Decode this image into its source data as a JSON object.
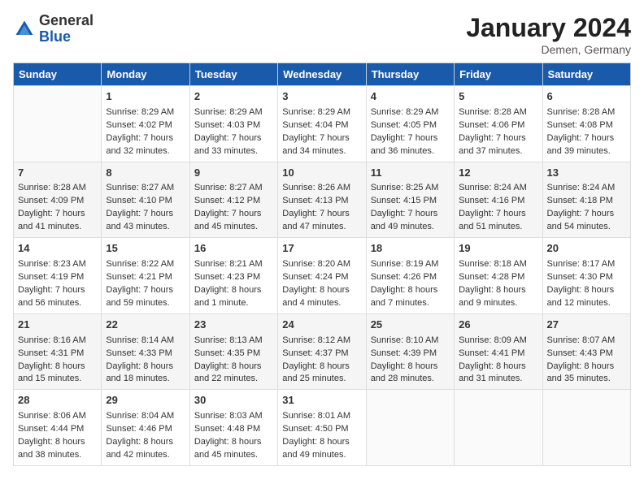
{
  "header": {
    "logo_general": "General",
    "logo_blue": "Blue",
    "month_title": "January 2024",
    "location": "Demen, Germany"
  },
  "days_of_week": [
    "Sunday",
    "Monday",
    "Tuesday",
    "Wednesday",
    "Thursday",
    "Friday",
    "Saturday"
  ],
  "weeks": [
    [
      {
        "day": "",
        "empty": true
      },
      {
        "day": "1",
        "sunrise": "Sunrise: 8:29 AM",
        "sunset": "Sunset: 4:02 PM",
        "daylight": "Daylight: 7 hours and 32 minutes."
      },
      {
        "day": "2",
        "sunrise": "Sunrise: 8:29 AM",
        "sunset": "Sunset: 4:03 PM",
        "daylight": "Daylight: 7 hours and 33 minutes."
      },
      {
        "day": "3",
        "sunrise": "Sunrise: 8:29 AM",
        "sunset": "Sunset: 4:04 PM",
        "daylight": "Daylight: 7 hours and 34 minutes."
      },
      {
        "day": "4",
        "sunrise": "Sunrise: 8:29 AM",
        "sunset": "Sunset: 4:05 PM",
        "daylight": "Daylight: 7 hours and 36 minutes."
      },
      {
        "day": "5",
        "sunrise": "Sunrise: 8:28 AM",
        "sunset": "Sunset: 4:06 PM",
        "daylight": "Daylight: 7 hours and 37 minutes."
      },
      {
        "day": "6",
        "sunrise": "Sunrise: 8:28 AM",
        "sunset": "Sunset: 4:08 PM",
        "daylight": "Daylight: 7 hours and 39 minutes."
      }
    ],
    [
      {
        "day": "7",
        "sunrise": "Sunrise: 8:28 AM",
        "sunset": "Sunset: 4:09 PM",
        "daylight": "Daylight: 7 hours and 41 minutes."
      },
      {
        "day": "8",
        "sunrise": "Sunrise: 8:27 AM",
        "sunset": "Sunset: 4:10 PM",
        "daylight": "Daylight: 7 hours and 43 minutes."
      },
      {
        "day": "9",
        "sunrise": "Sunrise: 8:27 AM",
        "sunset": "Sunset: 4:12 PM",
        "daylight": "Daylight: 7 hours and 45 minutes."
      },
      {
        "day": "10",
        "sunrise": "Sunrise: 8:26 AM",
        "sunset": "Sunset: 4:13 PM",
        "daylight": "Daylight: 7 hours and 47 minutes."
      },
      {
        "day": "11",
        "sunrise": "Sunrise: 8:25 AM",
        "sunset": "Sunset: 4:15 PM",
        "daylight": "Daylight: 7 hours and 49 minutes."
      },
      {
        "day": "12",
        "sunrise": "Sunrise: 8:24 AM",
        "sunset": "Sunset: 4:16 PM",
        "daylight": "Daylight: 7 hours and 51 minutes."
      },
      {
        "day": "13",
        "sunrise": "Sunrise: 8:24 AM",
        "sunset": "Sunset: 4:18 PM",
        "daylight": "Daylight: 7 hours and 54 minutes."
      }
    ],
    [
      {
        "day": "14",
        "sunrise": "Sunrise: 8:23 AM",
        "sunset": "Sunset: 4:19 PM",
        "daylight": "Daylight: 7 hours and 56 minutes."
      },
      {
        "day": "15",
        "sunrise": "Sunrise: 8:22 AM",
        "sunset": "Sunset: 4:21 PM",
        "daylight": "Daylight: 7 hours and 59 minutes."
      },
      {
        "day": "16",
        "sunrise": "Sunrise: 8:21 AM",
        "sunset": "Sunset: 4:23 PM",
        "daylight": "Daylight: 8 hours and 1 minute."
      },
      {
        "day": "17",
        "sunrise": "Sunrise: 8:20 AM",
        "sunset": "Sunset: 4:24 PM",
        "daylight": "Daylight: 8 hours and 4 minutes."
      },
      {
        "day": "18",
        "sunrise": "Sunrise: 8:19 AM",
        "sunset": "Sunset: 4:26 PM",
        "daylight": "Daylight: 8 hours and 7 minutes."
      },
      {
        "day": "19",
        "sunrise": "Sunrise: 8:18 AM",
        "sunset": "Sunset: 4:28 PM",
        "daylight": "Daylight: 8 hours and 9 minutes."
      },
      {
        "day": "20",
        "sunrise": "Sunrise: 8:17 AM",
        "sunset": "Sunset: 4:30 PM",
        "daylight": "Daylight: 8 hours and 12 minutes."
      }
    ],
    [
      {
        "day": "21",
        "sunrise": "Sunrise: 8:16 AM",
        "sunset": "Sunset: 4:31 PM",
        "daylight": "Daylight: 8 hours and 15 minutes."
      },
      {
        "day": "22",
        "sunrise": "Sunrise: 8:14 AM",
        "sunset": "Sunset: 4:33 PM",
        "daylight": "Daylight: 8 hours and 18 minutes."
      },
      {
        "day": "23",
        "sunrise": "Sunrise: 8:13 AM",
        "sunset": "Sunset: 4:35 PM",
        "daylight": "Daylight: 8 hours and 22 minutes."
      },
      {
        "day": "24",
        "sunrise": "Sunrise: 8:12 AM",
        "sunset": "Sunset: 4:37 PM",
        "daylight": "Daylight: 8 hours and 25 minutes."
      },
      {
        "day": "25",
        "sunrise": "Sunrise: 8:10 AM",
        "sunset": "Sunset: 4:39 PM",
        "daylight": "Daylight: 8 hours and 28 minutes."
      },
      {
        "day": "26",
        "sunrise": "Sunrise: 8:09 AM",
        "sunset": "Sunset: 4:41 PM",
        "daylight": "Daylight: 8 hours and 31 minutes."
      },
      {
        "day": "27",
        "sunrise": "Sunrise: 8:07 AM",
        "sunset": "Sunset: 4:43 PM",
        "daylight": "Daylight: 8 hours and 35 minutes."
      }
    ],
    [
      {
        "day": "28",
        "sunrise": "Sunrise: 8:06 AM",
        "sunset": "Sunset: 4:44 PM",
        "daylight": "Daylight: 8 hours and 38 minutes."
      },
      {
        "day": "29",
        "sunrise": "Sunrise: 8:04 AM",
        "sunset": "Sunset: 4:46 PM",
        "daylight": "Daylight: 8 hours and 42 minutes."
      },
      {
        "day": "30",
        "sunrise": "Sunrise: 8:03 AM",
        "sunset": "Sunset: 4:48 PM",
        "daylight": "Daylight: 8 hours and 45 minutes."
      },
      {
        "day": "31",
        "sunrise": "Sunrise: 8:01 AM",
        "sunset": "Sunset: 4:50 PM",
        "daylight": "Daylight: 8 hours and 49 minutes."
      },
      {
        "day": "",
        "empty": true
      },
      {
        "day": "",
        "empty": true
      },
      {
        "day": "",
        "empty": true
      }
    ]
  ]
}
